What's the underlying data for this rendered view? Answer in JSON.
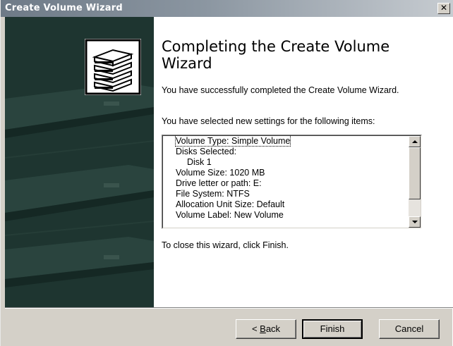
{
  "window": {
    "title": "Create Volume Wizard",
    "close_glyph": "✕"
  },
  "side_panel": {
    "icon": "server-stack-icon"
  },
  "heading": "Completing the Create Volume Wizard",
  "success_text": "You have successfully completed the Create Volume Wizard.",
  "settings_intro": "You have selected new settings for the following items:",
  "settings": [
    {
      "text": "Volume Type: Simple Volume",
      "indent": false,
      "focused": true
    },
    {
      "text": "Disks Selected:",
      "indent": false
    },
    {
      "text": "Disk 1",
      "indent": true
    },
    {
      "text": "Volume Size: 1020 MB",
      "indent": false
    },
    {
      "text": "Drive letter or path: E:",
      "indent": false
    },
    {
      "text": "File System: NTFS",
      "indent": false
    },
    {
      "text": "Allocation Unit Size: Default",
      "indent": false
    },
    {
      "text": "Volume Label: New Volume",
      "indent": false
    }
  ],
  "close_instruction": "To close this wizard, click Finish.",
  "buttons": {
    "back": {
      "prefix": "< ",
      "accel": "B",
      "rest": "ack"
    },
    "finish": "Finish",
    "cancel": "Cancel"
  },
  "colors": {
    "side_panel": "#1e3530",
    "dialog": "#d4d0c8"
  }
}
